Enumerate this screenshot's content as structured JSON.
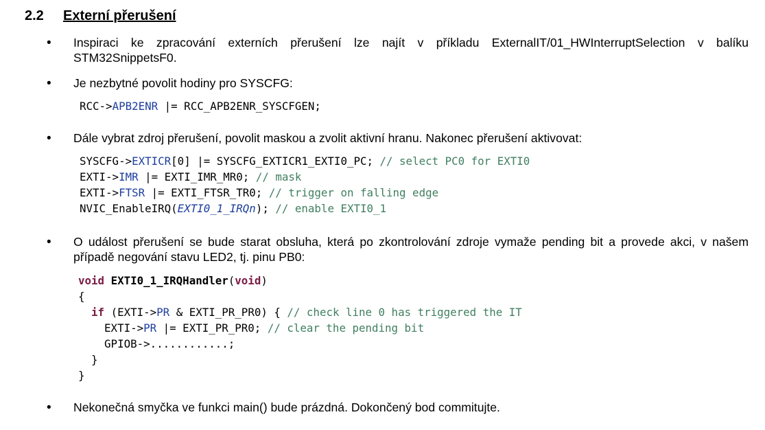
{
  "section": {
    "number": "2.2",
    "title": "Externí přerušení"
  },
  "bullet_symbol": "•",
  "items": [
    {
      "text": "Inspiraci ke zpracování externích přerušení lze najít v příkladu ExternalIT/01_HWInterruptSelection v balíku STM32SnippetsF0."
    },
    {
      "text": "Je nezbytné povolit hodiny pro SYSCFG:"
    },
    {
      "text": "Dále vybrat zdroj přerušení, povolit maskou a zvolit aktivní hranu. Nakonec přerušení aktivovat:"
    },
    {
      "text": "O událost přerušení se bude starat obsluha, která po zkontrolování zdroje vymaže pending bit a provede akci, v našem případě negování stavu LED2, tj. pinu PB0:"
    },
    {
      "text": "Nekonečná smyčka ve funkci main() bude prázdná. Dokončený bod commitujte."
    }
  ],
  "code_syscfg": [
    [
      "RCC->",
      "APB2ENR",
      " |= RCC_APB2ENR_SYSCFGEN;"
    ]
  ],
  "code_exti": [
    [
      "SYSCFG->",
      "EXTICR",
      "[0] |= SYSCFG_EXTICR1_EXTI0_PC; ",
      "// select PC0 for EXTI0"
    ],
    [
      "EXTI->",
      "IMR",
      " |= EXTI_IMR_MR0; ",
      "// mask"
    ],
    [
      "EXTI->",
      "FTSR",
      " |= EXTI_FTSR_TR0; ",
      "// trigger on falling edge"
    ],
    [
      "NVIC_EnableIRQ(",
      "EXTI0_1_IRQn",
      "); ",
      "// enable EXTI0_1"
    ]
  ],
  "code_handler": {
    "l1": [
      "void",
      " ",
      "EXTI0_1_IRQHandler",
      "(",
      "void",
      ")"
    ],
    "l2": "{",
    "l3": [
      "  ",
      "if",
      " (EXTI->",
      "PR",
      " & EXTI_PR_PR0) { ",
      "// check line 0 has triggered the IT"
    ],
    "l4": [
      "    EXTI->",
      "PR",
      " |= EXTI_PR_PR0; ",
      "// clear the pending bit"
    ],
    "l5": "    GPIOB->............;",
    "l6": "  }",
    "l7": "}"
  },
  "colors": {
    "keyword": "#7b1b44",
    "field": "#1c3e9c",
    "comment": "#3f7f5f"
  }
}
